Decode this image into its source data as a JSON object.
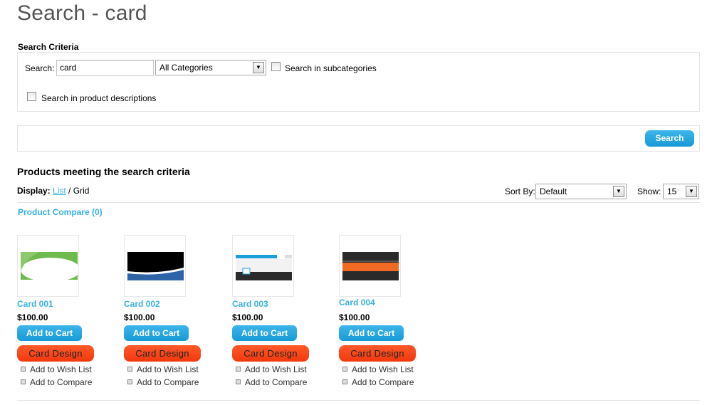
{
  "page": {
    "title": "Search - card"
  },
  "criteria": {
    "heading": "Search Criteria",
    "search_label": "Search:",
    "search_value": "card",
    "category_selected": "All Categories",
    "subcategories_label": "Search in subcategories",
    "descriptions_label": "Search in product descriptions",
    "search_button": "Search"
  },
  "results": {
    "heading": "Products meeting the search criteria",
    "display_label": "Display:",
    "display_list": "List",
    "display_sep": " / ",
    "display_grid": "Grid",
    "sort_label": "Sort By:",
    "sort_selected": "Default",
    "show_label": "Show:",
    "show_selected": "15",
    "compare_link": "Product Compare (0)"
  },
  "products": [
    {
      "name": "Card 001",
      "price": "$100.00",
      "cart": "Add to Cart",
      "design": "Card Design",
      "wish": "Add to Wish List",
      "compare": "Add to Compare"
    },
    {
      "name": "Card 002",
      "price": "$100.00",
      "cart": "Add to Cart",
      "design": "Card Design",
      "wish": "Add to Wish List",
      "compare": "Add to Compare"
    },
    {
      "name": "Card 003",
      "price": "$100.00",
      "cart": "Add to Cart",
      "design": "Card Design",
      "wish": "Add to Wish List",
      "compare": "Add to Compare"
    },
    {
      "name": "Card 004",
      "price": "$100.00",
      "cart": "Add to Cart",
      "design": "Card Design",
      "wish": "Add to Wish List",
      "compare": "Add to Compare"
    }
  ],
  "icons": {
    "dropdown": "chevron-down-icon",
    "bullet": "square-bullet-icon"
  },
  "colors": {
    "link": "#38b0e3",
    "button_blue": "#1ea3de",
    "button_orange": "#f54416",
    "title_gray": "#555555"
  }
}
